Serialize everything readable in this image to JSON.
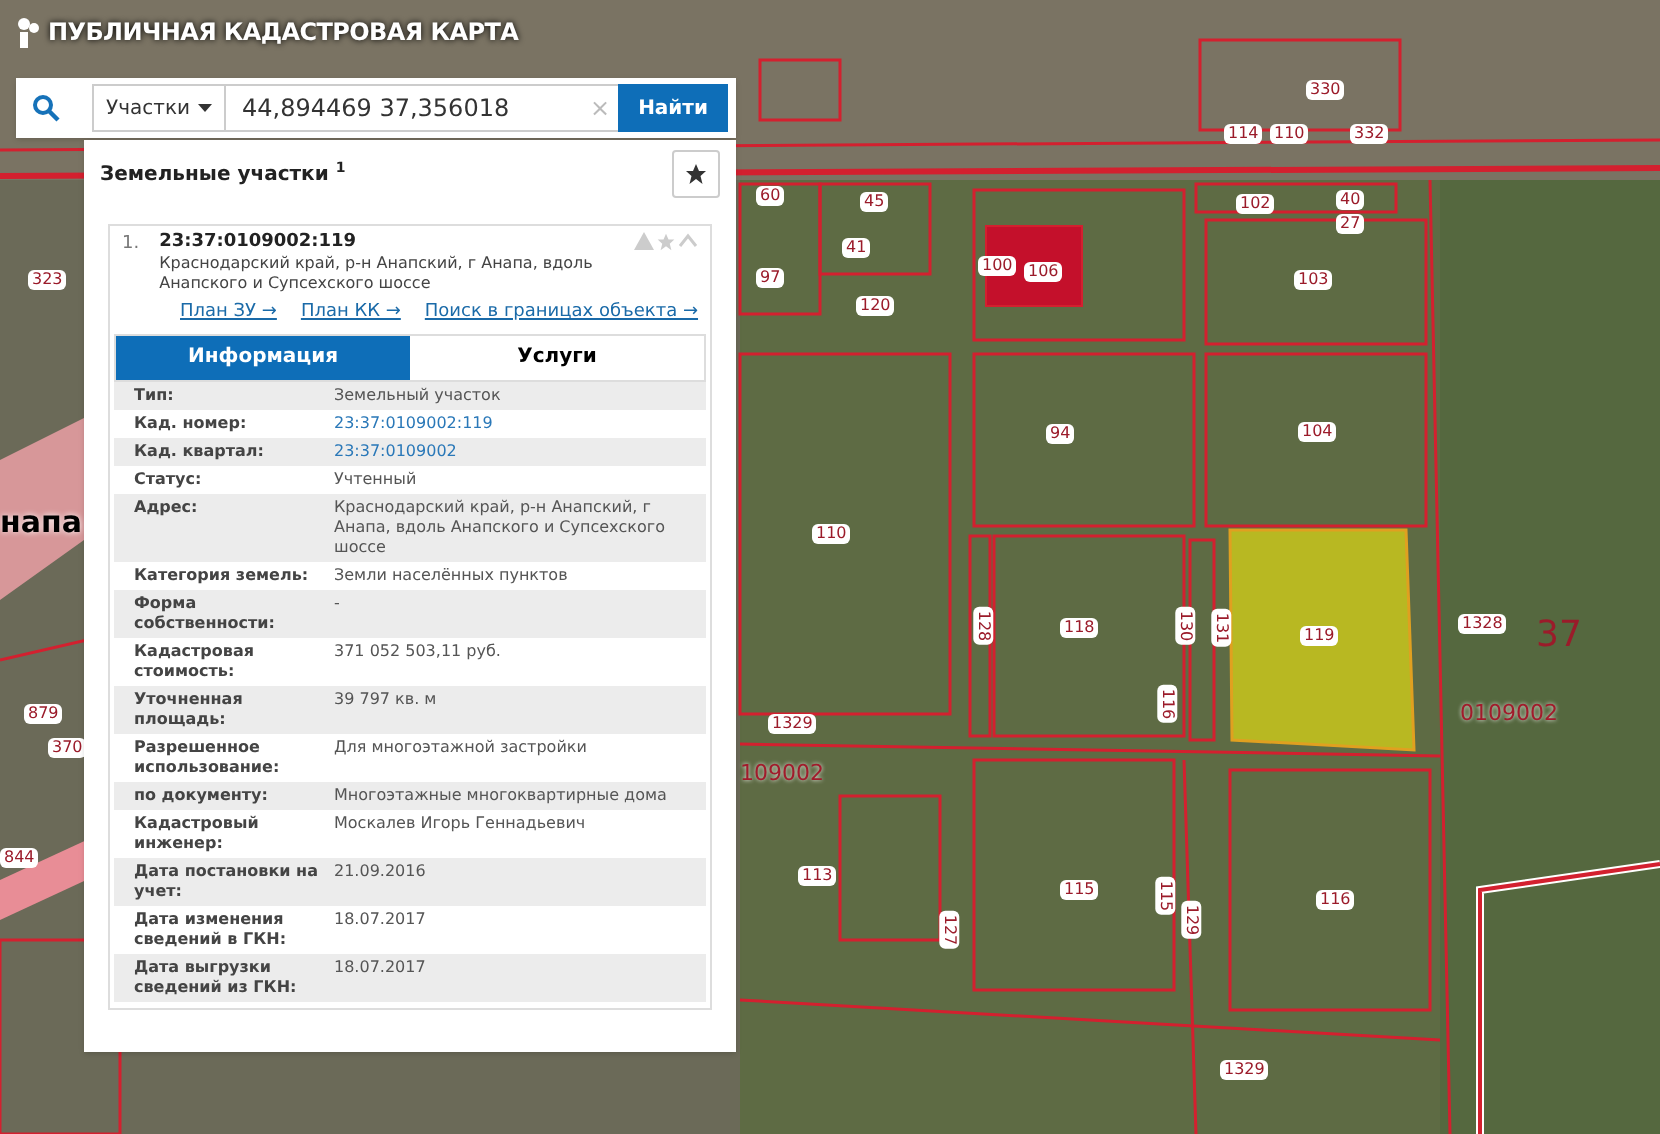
{
  "app_title": "ПУБЛИЧНАЯ КАДАСТРОВАЯ КАРТА",
  "search": {
    "category": "Участки",
    "value": "44,894469 37,356018",
    "clear": "×",
    "button": "Найти"
  },
  "results": {
    "title": "Земельные участки",
    "count": "1"
  },
  "item": {
    "index": "1.",
    "number": "23:37:0109002:119",
    "address": "Краснодарский край, р-н Анапский, г Анапа, вдоль Анапского и Супсехского шоссе"
  },
  "links": [
    "План ЗУ →",
    "План КК →",
    "Поиск в границах объекта →"
  ],
  "tabs": [
    {
      "label": "Информация",
      "selected": true
    },
    {
      "label": "Услуги",
      "selected": false
    }
  ],
  "rows": [
    {
      "label": "Тип:",
      "value": "Земельный участок",
      "kind": "text"
    },
    {
      "label": "Кад. номер:",
      "value": "23:37:0109002:119",
      "kind": "link"
    },
    {
      "label": "Кад. квартал:",
      "value": "23:37:0109002",
      "kind": "link"
    },
    {
      "label": "Статус:",
      "value": "Учтенный",
      "kind": "text"
    },
    {
      "label": "Адрес:",
      "value": "Краснодарский край, р-н Анапский, г Анапа, вдоль Анапского и Супсехского шоссе",
      "kind": "text"
    },
    {
      "label": "Категория земель:",
      "value": "Земли населённых пунктов",
      "kind": "text"
    },
    {
      "label": "Форма собственности:",
      "value": "-",
      "kind": "text"
    },
    {
      "label": "Кадастровая стоимость:",
      "value": "371 052 503,11 руб.",
      "kind": "text"
    },
    {
      "label": "Уточненная площадь:",
      "value": "39 797 кв. м",
      "kind": "text"
    },
    {
      "label": "Разрешенное использование:",
      "value": "Для многоэтажной застройки",
      "kind": "text"
    },
    {
      "label": "по документу:",
      "value": "Многоэтажные многоквартирные дома",
      "kind": "text"
    },
    {
      "label": "Кадастровый инженер:",
      "value": "Москалев Игорь Геннадьевич",
      "kind": "text"
    },
    {
      "label": "Дата постановки на учет:",
      "value": "21.09.2016",
      "kind": "text"
    },
    {
      "label": "Дата изменения сведений в ГКН:",
      "value": "18.07.2017",
      "kind": "text"
    },
    {
      "label": "Дата выгрузки сведений из ГКН:",
      "value": "18.07.2017",
      "kind": "text"
    }
  ],
  "map_labels": [
    {
      "text": "60",
      "kind": "parcel"
    },
    {
      "text": "45",
      "kind": "parcel"
    },
    {
      "text": "41",
      "kind": "parcel"
    },
    {
      "text": "97",
      "kind": "parcel"
    },
    {
      "text": "120",
      "kind": "parcel"
    },
    {
      "text": "100",
      "kind": "parcel"
    },
    {
      "text": "106",
      "kind": "parcel"
    },
    {
      "text": "102",
      "kind": "parcel"
    },
    {
      "text": "40",
      "kind": "parcel"
    },
    {
      "text": "27",
      "kind": "parcel"
    },
    {
      "text": "103",
      "kind": "parcel"
    },
    {
      "text": "94",
      "kind": "parcel"
    },
    {
      "text": "104",
      "kind": "parcel"
    },
    {
      "text": "110",
      "kind": "parcel"
    },
    {
      "text": "118",
      "kind": "parcel"
    },
    {
      "text": "128",
      "kind": "parcel"
    },
    {
      "text": "130",
      "kind": "parcel"
    },
    {
      "text": "131",
      "kind": "parcel"
    },
    {
      "text": "116",
      "kind": "parcel"
    },
    {
      "text": "119",
      "kind": "parcel"
    },
    {
      "text": "1328",
      "kind": "parcel"
    },
    {
      "text": "1329",
      "kind": "parcel"
    },
    {
      "text": "113",
      "kind": "parcel"
    },
    {
      "text": "115",
      "kind": "parcel"
    },
    {
      "text": "115",
      "kind": "parcel"
    },
    {
      "text": "129",
      "kind": "parcel"
    },
    {
      "text": "116",
      "kind": "parcel"
    },
    {
      "text": "127",
      "kind": "parcel"
    },
    {
      "text": "1329",
      "kind": "parcel"
    },
    {
      "text": "37",
      "kind": "district"
    },
    {
      "text": "0109002",
      "kind": "quarter"
    },
    {
      "text": "109002",
      "kind": "quarter"
    },
    {
      "text": "напа",
      "kind": "city"
    },
    {
      "text": "332",
      "kind": "parcel"
    },
    {
      "text": "330",
      "kind": "parcel"
    },
    {
      "text": "114",
      "kind": "parcel"
    },
    {
      "text": "110",
      "kind": "parcel"
    },
    {
      "text": "323",
      "kind": "parcel"
    },
    {
      "text": "879",
      "kind": "parcel"
    },
    {
      "text": "370",
      "kind": "parcel"
    },
    {
      "text": "844",
      "kind": "parcel"
    }
  ]
}
